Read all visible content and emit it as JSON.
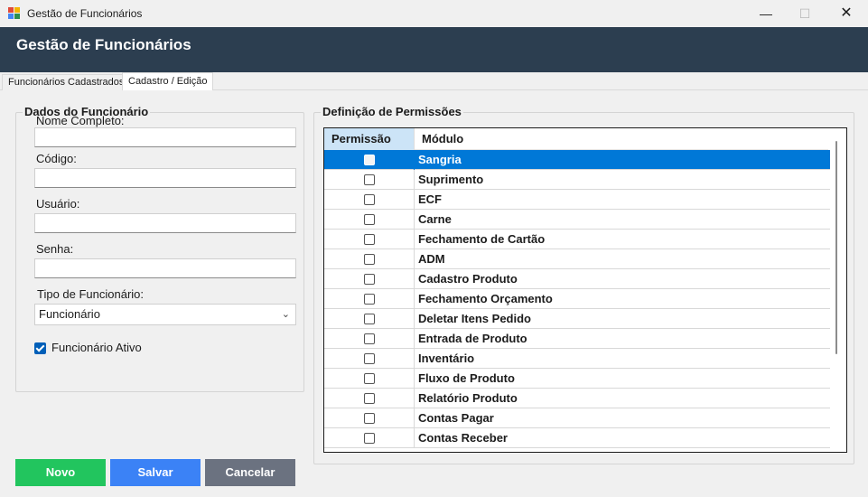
{
  "window": {
    "title": "Gestão de Funcionários",
    "minimize": "—",
    "maximize": "☐",
    "close": "✕"
  },
  "header": {
    "title": "Gestão de Funcionários"
  },
  "tabs": [
    {
      "label": "Funcionários Cadastrados",
      "active": false
    },
    {
      "label": "Cadastro / Edição",
      "active": true
    }
  ],
  "dados": {
    "title": "Dados do Funcionário",
    "nome_label": "Nome Completo:",
    "nome_value": "",
    "codigo_label": "Código:",
    "codigo_value": "",
    "usuario_label": "Usuário:",
    "usuario_value": "",
    "senha_label": "Senha:",
    "senha_value": "",
    "tipo_label": "Tipo de Funcionário:",
    "tipo_value": "Funcionário",
    "ativo_label": "Funcionário Ativo",
    "ativo_checked": true
  },
  "permissoes": {
    "title": "Definição de Permissões",
    "col_permissao": "Permissão",
    "col_modulo": "Módulo",
    "rows": [
      {
        "modulo": "Sangria",
        "checked": false,
        "selected": true
      },
      {
        "modulo": "Suprimento",
        "checked": false,
        "selected": false
      },
      {
        "modulo": "ECF",
        "checked": false,
        "selected": false
      },
      {
        "modulo": "Carne",
        "checked": false,
        "selected": false
      },
      {
        "modulo": "Fechamento de Cartão",
        "checked": false,
        "selected": false
      },
      {
        "modulo": "ADM",
        "checked": false,
        "selected": false
      },
      {
        "modulo": "Cadastro Produto",
        "checked": false,
        "selected": false
      },
      {
        "modulo": "Fechamento Orçamento",
        "checked": false,
        "selected": false
      },
      {
        "modulo": "Deletar Itens Pedido",
        "checked": false,
        "selected": false
      },
      {
        "modulo": "Entrada de Produto",
        "checked": false,
        "selected": false
      },
      {
        "modulo": "Inventário",
        "checked": false,
        "selected": false
      },
      {
        "modulo": "Fluxo de Produto",
        "checked": false,
        "selected": false
      },
      {
        "modulo": "Relatório Produto",
        "checked": false,
        "selected": false
      },
      {
        "modulo": "Contas Pagar",
        "checked": false,
        "selected": false
      },
      {
        "modulo": "Contas Receber",
        "checked": false,
        "selected": false
      }
    ]
  },
  "buttons": {
    "novo": "Novo",
    "salvar": "Salvar",
    "cancelar": "Cancelar"
  },
  "colors": {
    "header_bg": "#2c3e50",
    "selection": "#0078d7",
    "novo": "#22c55e",
    "salvar": "#3b82f6",
    "cancelar": "#6b7280"
  }
}
